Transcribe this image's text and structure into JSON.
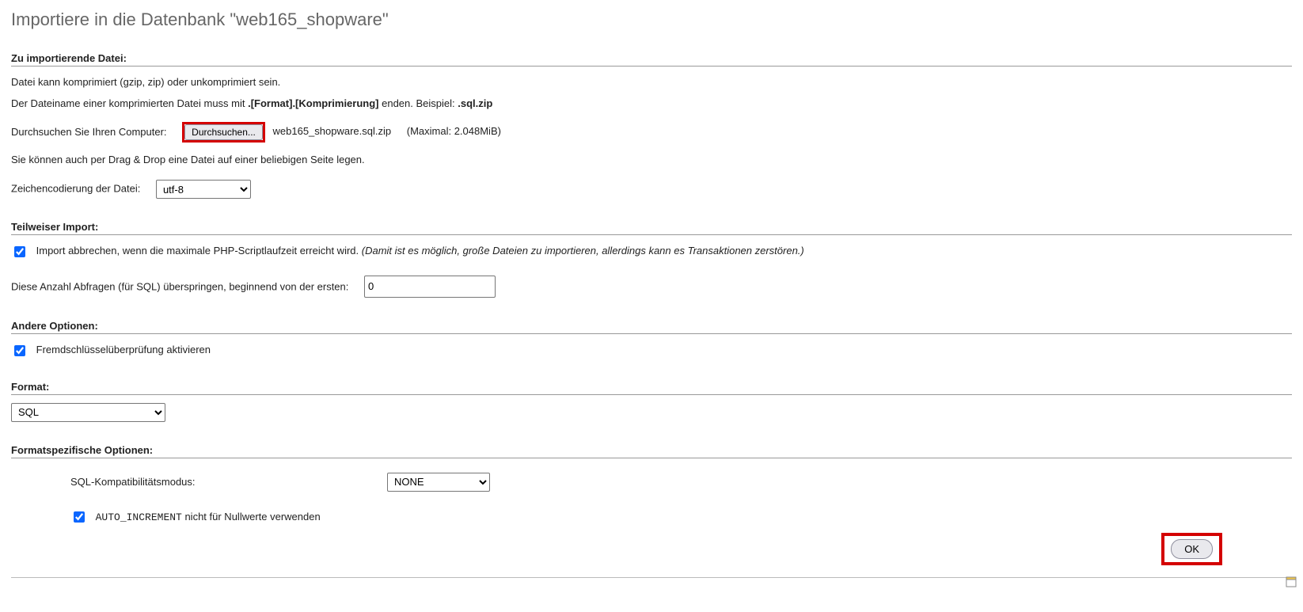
{
  "title": "Importiere in die Datenbank \"web165_shopware\"",
  "file_section": {
    "heading": "Zu importierende Datei:",
    "line1": "Datei kann komprimiert (gzip, zip) oder unkomprimiert sein.",
    "line2a": "Der Dateiname einer komprimierten Datei muss mit ",
    "line2b": ".[Format].[Komprimierung]",
    "line2c": " enden. Beispiel: ",
    "line2d": ".sql.zip",
    "browse_label": "Durchsuchen Sie Ihren Computer:",
    "browse_button": "Durchsuchen...",
    "selected_file": "web165_shopware.sql.zip",
    "max_size": "(Maximal: 2.048MiB)",
    "dragdrop": "Sie können auch per Drag & Drop eine Datei auf einer beliebigen Seite legen.",
    "charset_label": "Zeichencodierung der Datei:",
    "charset_value": "utf-8"
  },
  "partial_section": {
    "heading": "Teilweiser Import:",
    "abort_label": "Import abbrechen, wenn die maximale PHP-Scriptlaufzeit erreicht wird. ",
    "abort_note": "(Damit ist es möglich, große Dateien zu importieren, allerdings kann es Transaktionen zerstören.)",
    "skip_label": "Diese Anzahl Abfragen (für SQL) überspringen, beginnend von der ersten:",
    "skip_value": "0"
  },
  "other_section": {
    "heading": "Andere Optionen:",
    "fk_label": "Fremdschlüsselüberprüfung aktivieren"
  },
  "format_section": {
    "heading": "Format:",
    "value": "SQL"
  },
  "specific_section": {
    "heading": "Formatspezifische Optionen:",
    "compat_label": "SQL-Kompatibilitätsmodus:",
    "compat_value": "NONE",
    "ai_code": "AUTO_INCREMENT",
    "ai_rest": " nicht für Nullwerte verwenden"
  },
  "ok_label": "OK"
}
